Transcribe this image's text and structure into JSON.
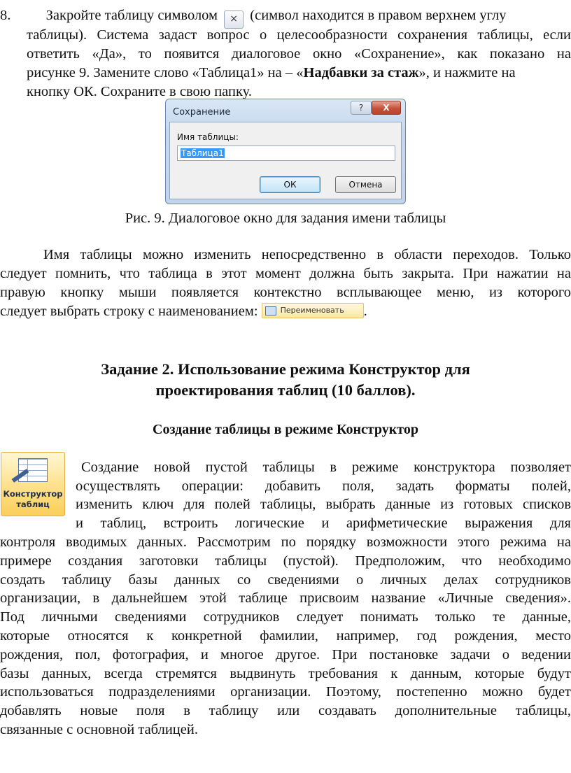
{
  "item8": {
    "number": "8.",
    "line1_before": "Закройте таблицу символом",
    "close_glyph": "×",
    "line1_after": "(символ находится в правом верхнем углу",
    "line2": "таблицы). Система задаст вопрос о целесообразности сохранения таблицы, если",
    "line3": "ответить «Да», то появится диалоговое окно «Сохранение», как показано на",
    "line4_before": "рисунке 9. Замените слово «Таблица1» на – «",
    "line4_bold": "Надбавки за стаж",
    "line4_after": "», и нажмите на",
    "line5": "кнопку ОК. Сохраните в свою папку."
  },
  "dialog": {
    "title": "Сохранение",
    "help_label": "?",
    "close_label": "X",
    "field_label": "Имя таблицы:",
    "field_value": "Таблица1",
    "ok_label": "ОК",
    "cancel_label": "Отмена"
  },
  "figure_caption": "Рис. 9. Диалоговое окно для задания имени таблицы",
  "rename_para": {
    "line1": "Имя таблицы можно изменить непосредственно в области переходов. Только",
    "line2": "следует помнить, что таблица в этот момент должна быть закрыта. При нажатии на",
    "line3": "правую кнопку мыши появляется контекстно всплывающее меню, из которого",
    "line4_before": "следует выбрать строку с наименованием:",
    "menu_item_label": "Переименовать",
    "line4_after": "."
  },
  "task2": {
    "heading_line1": "Задание 2. Использование режима Конструктор для",
    "heading_line2": "проектирования таблиц (10 баллов).",
    "subheading": "Создание таблицы в режиме Конструктор"
  },
  "constructor_icon": {
    "label_line1": "Конструктор",
    "label_line2": "таблиц"
  },
  "body_para": {
    "lines": [
      "Создание новой пустой таблицы в режиме конструктора позволяет",
      "осуществлять операции: добавить поля, задать форматы полей,",
      "изменить ключ для полей таблицы, выбрать данные из готовых списков",
      "и таблиц, встроить логические и арифметические выражения для",
      "контроля вводимых данных. Рассмотрим по порядку возможности этого режима на",
      "примере создания заготовки таблицы (пустой). Предположим, что необходимо",
      "создать таблицу базы данных со сведениями о личных делах сотрудников",
      "организации, в дальнейшем этой таблице присвоим название «Личные сведения».",
      "Под личными сведениями сотрудников следует понимать только те данные,",
      "которые относятся к конкретной фамилии, например, год рождения, место",
      "рождения, пол, фотография, и многое другое. При постановке задачи о ведении",
      "базы данных, всегда стремятся выдвинуть требования к данным, которые будут",
      "использоваться подразделениями организации. Поэтому, постепенно можно будет",
      "добавлять новые поля в таблицу или создавать дополнительные таблицы,",
      "связанные с основной таблицей."
    ]
  }
}
